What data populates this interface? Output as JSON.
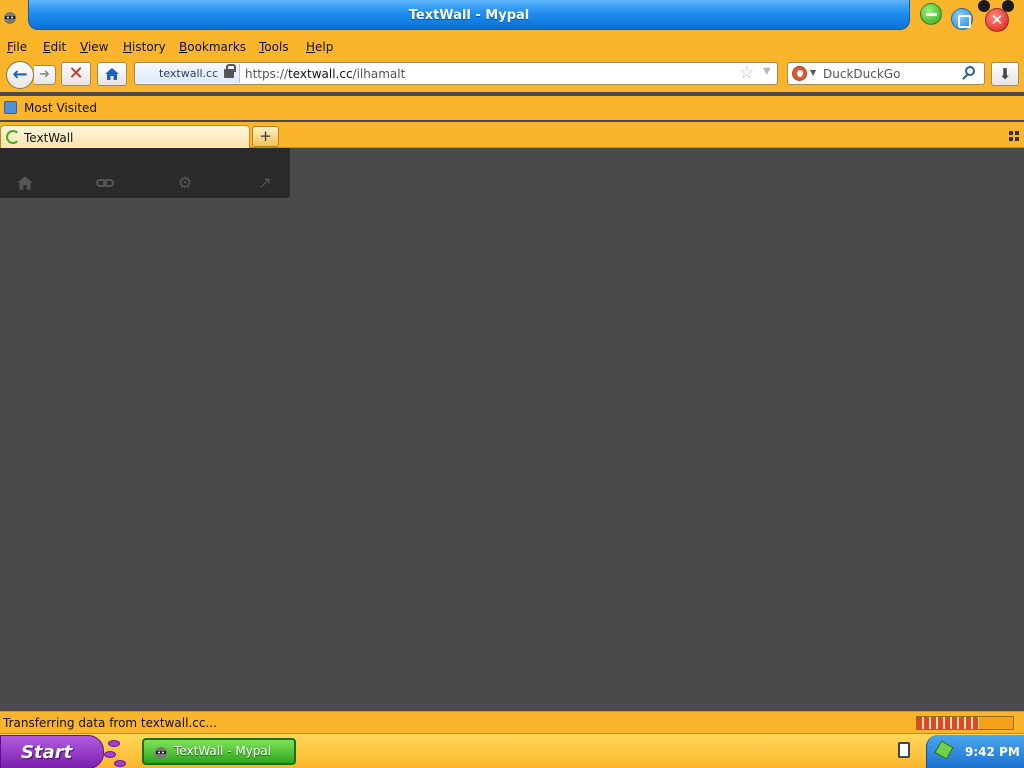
{
  "window": {
    "title": "TextWall - Mypal"
  },
  "menu": {
    "items": [
      {
        "label": "File",
        "key": "F",
        "rest": "ile"
      },
      {
        "label": "Edit",
        "key": "E",
        "rest": "dit"
      },
      {
        "label": "View",
        "key": "V",
        "rest": "iew"
      },
      {
        "label": "History",
        "key": "H",
        "rest": "istory"
      },
      {
        "label": "Bookmarks",
        "key": "B",
        "rest": "ookmarks"
      },
      {
        "label": "Tools",
        "key": "T",
        "rest": "ools"
      },
      {
        "label": "Help",
        "key": "H",
        "rest": "elp"
      }
    ]
  },
  "navbar": {
    "site_identity": "textwall.cc",
    "url_scheme": "https://",
    "url_host": "textwall.cc",
    "url_path": "/ilhamalt",
    "search_placeholder": "DuckDuckGo"
  },
  "bookmarks": {
    "items": [
      {
        "label": "Most Visited"
      }
    ]
  },
  "tabs": [
    {
      "label": "TextWall",
      "loading": true
    }
  ],
  "status": {
    "text": "Transferring data from textwall.cc...",
    "progress": 0.65
  },
  "taskbar": {
    "start_label": "Start",
    "task_label": "TextWall - Mypal",
    "clock": "9:42 PM"
  },
  "colors": {
    "chrome": "#fbb52c",
    "title_blue": "#1f8eef",
    "content_bg": "#4a4a4a",
    "task_green": "#2fa51c",
    "start_purple": "#7a1fb0"
  },
  "icons": [
    "raccoon-app-icon",
    "minimize-icon",
    "maximize-icon",
    "close-icon",
    "back-arrow-icon",
    "forward-arrow-icon",
    "stop-icon",
    "home-icon",
    "lock-icon",
    "star-icon",
    "dropdown-icon",
    "duckduckgo-icon",
    "search-icon",
    "download-icon",
    "most-visited-icon",
    "loading-throbber-icon",
    "new-tab-icon",
    "tab-groups-icon",
    "page-home-icon",
    "link-icon",
    "settings-gear-icon",
    "external-arrow-icon",
    "printer-tray-icon",
    "network-tray-icon"
  ]
}
